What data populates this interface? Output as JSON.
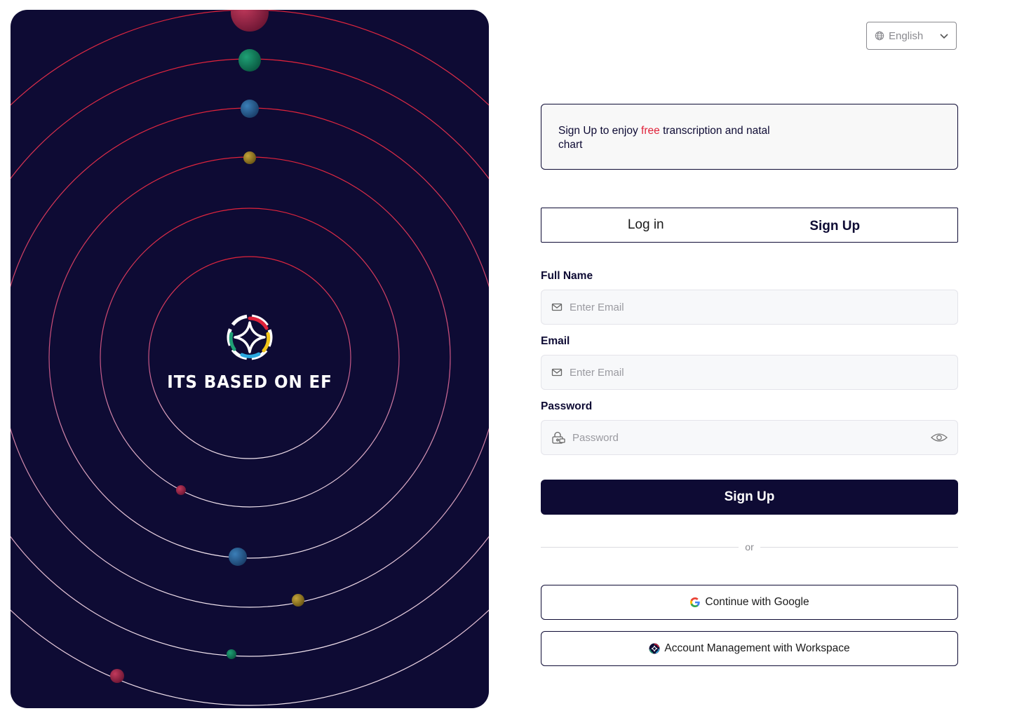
{
  "brand": {
    "name": "ITS BASED ON EF",
    "logo_icon": "diamond-star-ring-icon"
  },
  "language": {
    "selected": "English",
    "icon": "globe-icon",
    "dropdown_icon": "chevron-down-icon"
  },
  "promo": {
    "text_before": "Sign Up to enjoy ",
    "highlight": "free",
    "text_after": " transcription and natal chart",
    "highlight_color": "#e0223a"
  },
  "tabs": [
    {
      "label": "Log in",
      "active": false
    },
    {
      "label": "Sign Up",
      "active": true
    }
  ],
  "form": {
    "full_name": {
      "label": "Full Name",
      "placeholder": "Enter Email",
      "value": "",
      "icon": "mail-icon"
    },
    "email": {
      "label": "Email",
      "placeholder": "Enter Email",
      "value": "",
      "icon": "mail-icon"
    },
    "password": {
      "label": "Password",
      "placeholder": "Password",
      "value": "",
      "icon": "lock-icon",
      "toggle_icon": "eye-icon"
    },
    "submit_label": "Sign Up"
  },
  "divider": "or",
  "alt_actions": [
    {
      "label": "Continue with Google",
      "icon": "google-icon"
    },
    {
      "label": "Account Management with Workspace",
      "icon": "workspace-logo-icon"
    }
  ],
  "colors": {
    "primary": "#0e0b34",
    "accent": "#e0223a"
  }
}
